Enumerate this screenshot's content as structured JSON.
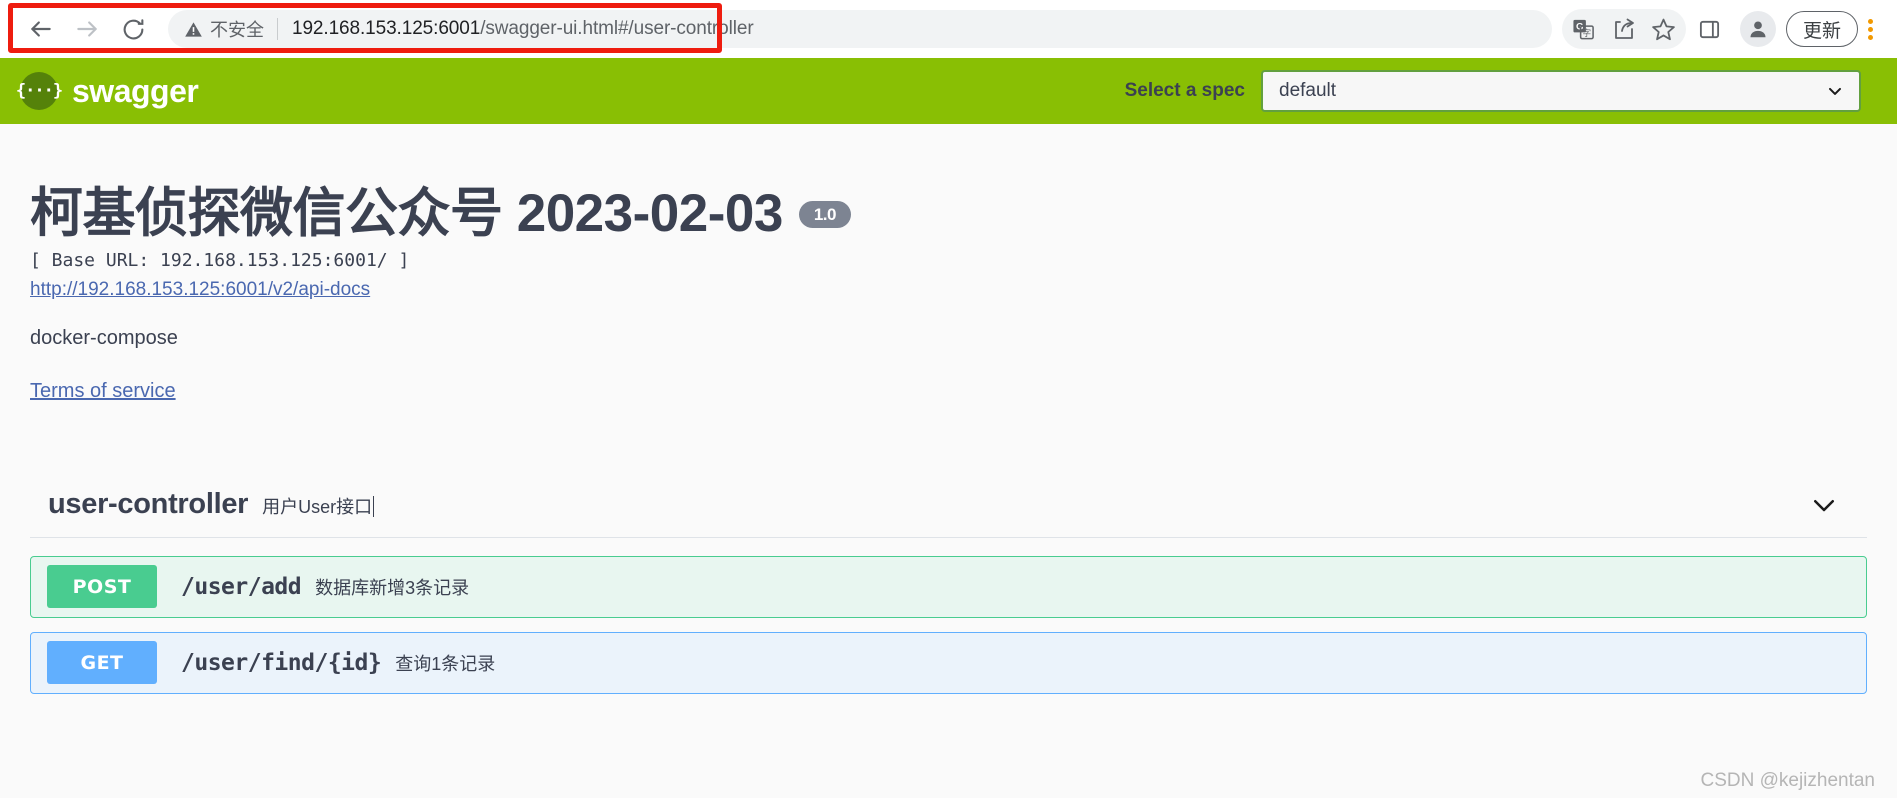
{
  "browser": {
    "back_icon": "arrow-left-icon",
    "forward_icon": "arrow-right-icon",
    "reload_icon": "reload-icon",
    "security_label": "不安全",
    "url_host": "192.168.153.125:6001",
    "url_path": "/swagger-ui.html#/user-controller",
    "url_full": "192.168.153.125:6001/swagger-ui.html#/user-controller",
    "highlight_color": "#ee1c0f",
    "toolbar": {
      "translate_icon": "translate-icon",
      "share_icon": "share-icon",
      "bookmark_icon": "star-icon",
      "side_panel_icon": "side-panel-icon",
      "profile_icon": "profile-avatar-icon",
      "update_label": "更新",
      "menu_icon": "kebab-menu-icon"
    }
  },
  "topbar": {
    "logo_glyph": "{···}",
    "logo_text": "swagger",
    "spec_label": "Select a spec",
    "spec_selected": "default",
    "spec_options": [
      "default"
    ],
    "bar_color": "#89bf04"
  },
  "info": {
    "title": "柯基侦探微信公众号 2023-02-03",
    "version": "1.0",
    "base_url": "[ Base URL: 192.168.153.125:6001/ ]",
    "api_docs_link": "http://192.168.153.125:6001/v2/api-docs",
    "description": "docker-compose",
    "terms_link": "Terms of service"
  },
  "tag": {
    "name": "user-controller",
    "description": "用户User接口",
    "expand_icon": "chevron-down-icon",
    "operations": [
      {
        "method": "POST",
        "path": "/user/add",
        "summary": "数据库新增3条记录",
        "color": "#49cc90"
      },
      {
        "method": "GET",
        "path": "/user/find/{id}",
        "summary": "查询1条记录",
        "color": "#61affe"
      }
    ]
  },
  "watermark": "CSDN @kejizhentan"
}
